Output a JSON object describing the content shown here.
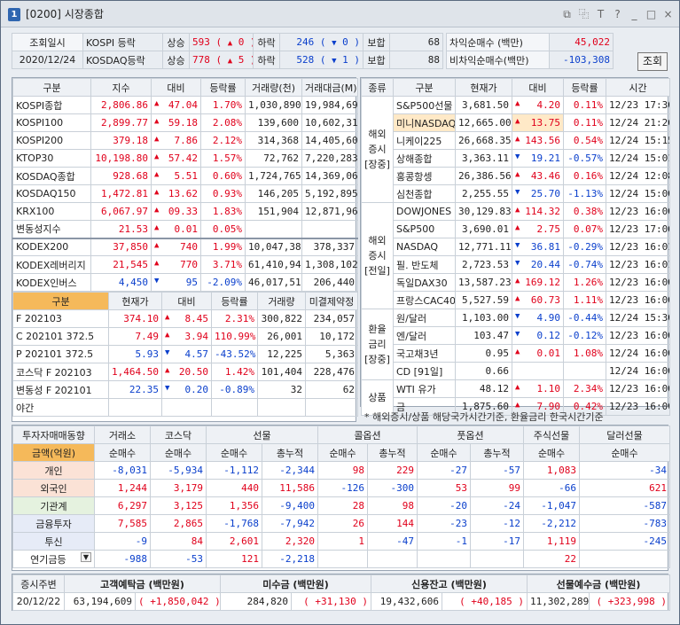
{
  "window": {
    "num": "1",
    "title": "[0200] 시장종합",
    "icons": [
      "layout-icon",
      "copy-icon",
      "T",
      "?",
      "_",
      "□",
      "×"
    ]
  },
  "summary": {
    "lookup_label": "조회일시",
    "date": "2020/12/24",
    "rows": [
      {
        "name": "KOSPI 등락",
        "up_label": "상승",
        "up": "593",
        "up_chg": "0",
        "down_label": "하락",
        "down": "246",
        "down_chg": "0",
        "flat_label": "보합",
        "flat": "68"
      },
      {
        "name": "KOSDAQ등락",
        "up_label": "상승",
        "up": "778",
        "up_chg": "5",
        "down_label": "하락",
        "down": "528",
        "down_chg": "1",
        "flat_label": "보합",
        "flat": "88"
      }
    ],
    "arb": [
      {
        "label": "차익순매수 (백만)",
        "value": "45,022"
      },
      {
        "label": "비차익순매수(백만)",
        "value": "-103,308"
      }
    ],
    "lookup_btn": "조회"
  },
  "indices": {
    "headers": [
      "구분",
      "지수",
      "대비",
      "등락률",
      "거래량(천)",
      "거래대금(M)"
    ],
    "rows": [
      {
        "name": "KOSPI종합",
        "v": "2,806.86",
        "dir": "up",
        "chg": "47.04",
        "pct": "1.70%",
        "vol": "1,030,890",
        "amt": "19,984,695"
      },
      {
        "name": "KOSPI100",
        "v": "2,899.77",
        "dir": "up",
        "chg": "59.18",
        "pct": "2.08%",
        "vol": "139,600",
        "amt": "10,602,313"
      },
      {
        "name": "KOSPI200",
        "v": "379.18",
        "dir": "up",
        "chg": "7.86",
        "pct": "2.12%",
        "vol": "314,368",
        "amt": "14,405,605"
      },
      {
        "name": "KTOP30",
        "v": "10,198.80",
        "dir": "up",
        "chg": "57.42",
        "pct": "1.57%",
        "vol": "72,762",
        "amt": "7,220,283"
      },
      {
        "name": "KOSDAQ종합",
        "v": "928.68",
        "dir": "up",
        "chg": "5.51",
        "pct": "0.60%",
        "vol": "1,724,765",
        "amt": "14,369,069"
      },
      {
        "name": "KOSDAQ150",
        "v": "1,472.81",
        "dir": "up",
        "chg": "13.62",
        "pct": "0.93%",
        "vol": "146,205",
        "amt": "5,192,895"
      },
      {
        "name": "KRX100",
        "v": "6,067.97",
        "dir": "up",
        "chg": "09.33",
        "pct": "1.83%",
        "vol": "151,904",
        "amt": "12,871,964"
      },
      {
        "name": "변동성지수",
        "v": "21.53",
        "dir": "up",
        "chg": "0.01",
        "pct": "0.05%",
        "vol": "",
        "amt": ""
      },
      {
        "name": "KODEX200",
        "v": "37,850",
        "dir": "up",
        "chg": "740",
        "pct": "1.99%",
        "vol": "10,047,380",
        "amt": "378,337"
      },
      {
        "name": "KODEX레버리지",
        "v": "21,545",
        "dir": "up",
        "chg": "770",
        "pct": "3.71%",
        "vol": "61,410,948",
        "amt": "1,308,102"
      },
      {
        "name": "KODEX인버스",
        "v": "4,450",
        "dir": "down",
        "chg": "95",
        "pct": "-2.09%",
        "vol": "46,017,519",
        "amt": "206,440"
      }
    ]
  },
  "futures": {
    "headers": [
      "구분",
      "현재가",
      "대비",
      "등락률",
      "거래량",
      "미결제약정"
    ],
    "rows": [
      {
        "name": "F 202103",
        "v": "374.10",
        "dir": "up",
        "chg": "8.45",
        "pct": "2.31%",
        "vol": "300,822",
        "oi": "234,057"
      },
      {
        "name": "C 202101 372.5",
        "v": "7.49",
        "dir": "up",
        "chg": "3.94",
        "pct": "110.99%",
        "vol": "26,001",
        "oi": "10,172"
      },
      {
        "name": "P 202101 372.5",
        "v": "5.93",
        "dir": "down",
        "chg": "4.57",
        "pct": "-43.52%",
        "vol": "12,225",
        "oi": "5,363"
      },
      {
        "name": "코스닥 F 202103",
        "v": "1,464.50",
        "dir": "up",
        "chg": "20.50",
        "pct": "1.42%",
        "vol": "101,404",
        "oi": "228,476"
      },
      {
        "name": "변동성 F 202101",
        "v": "22.35",
        "dir": "down",
        "chg": "0.20",
        "pct": "-0.89%",
        "vol": "32",
        "oi": "62"
      },
      {
        "name": "야간",
        "v": "",
        "dir": "",
        "chg": "",
        "pct": "",
        "vol": "",
        "oi": ""
      }
    ]
  },
  "global": {
    "headers": [
      "종류",
      "구분",
      "현재가",
      "대비",
      "등락률",
      "시간"
    ],
    "groups": [
      {
        "label": "해외\n증시\n[장중]",
        "rows": [
          {
            "name": "S&P500선물",
            "v": "3,681.50",
            "dir": "up",
            "chg": "4.20",
            "pct": "0.11%",
            "t": "12/23 17:30"
          },
          {
            "name": "미니NASDAQ",
            "v": "12,665.00",
            "dir": "up",
            "chg": "13.75",
            "pct": "0.11%",
            "t": "12/24 21:26",
            "hl": true
          },
          {
            "name": "니케이225",
            "v": "26,668.35",
            "dir": "up",
            "chg": "143.56",
            "pct": "0.54%",
            "t": "12/24 15:15"
          },
          {
            "name": "상해종합",
            "v": "3,363.11",
            "dir": "down",
            "chg": "19.21",
            "pct": "-0.57%",
            "t": "12/24 15:01"
          },
          {
            "name": "홍콩항셍",
            "v": "26,386.56",
            "dir": "up",
            "chg": "43.46",
            "pct": "0.16%",
            "t": "12/24 12:08"
          },
          {
            "name": "심천종합",
            "v": "2,255.55",
            "dir": "down",
            "chg": "25.70",
            "pct": "-1.13%",
            "t": "12/24 15:00"
          }
        ]
      },
      {
        "label": "해외\n증시\n[전일]",
        "rows": [
          {
            "name": "DOWJONES",
            "v": "30,129.83",
            "dir": "up",
            "chg": "114.32",
            "pct": "0.38%",
            "t": "12/23 16:00"
          },
          {
            "name": "S&P500",
            "v": "3,690.01",
            "dir": "up",
            "chg": "2.75",
            "pct": "0.07%",
            "t": "12/23 17:06"
          },
          {
            "name": "NASDAQ",
            "v": "12,771.11",
            "dir": "down",
            "chg": "36.81",
            "pct": "-0.29%",
            "t": "12/23 16:01"
          },
          {
            "name": "필. 반도체",
            "v": "2,723.53",
            "dir": "down",
            "chg": "20.44",
            "pct": "-0.74%",
            "t": "12/23 16:01"
          },
          {
            "name": "독일DAX30",
            "v": "13,587.23",
            "dir": "up",
            "chg": "169.12",
            "pct": "1.26%",
            "t": "12/23 16:00"
          },
          {
            "name": "프랑스CAC40",
            "v": "5,527.59",
            "dir": "up",
            "chg": "60.73",
            "pct": "1.11%",
            "t": "12/23 16:00"
          }
        ]
      },
      {
        "label": "환율\n금리\n[장중]",
        "rows": [
          {
            "name": "원/달러",
            "v": "1,103.00",
            "dir": "down",
            "chg": "4.90",
            "pct": "-0.44%",
            "t": "12/24 15:30"
          },
          {
            "name": "엔/달러",
            "v": "103.47",
            "dir": "down",
            "chg": "0.12",
            "pct": "-0.12%",
            "t": "12/23 16:00"
          },
          {
            "name": "국고채3년",
            "v": "0.95",
            "dir": "up",
            "chg": "0.01",
            "pct": "1.08%",
            "t": "12/24 16:00"
          },
          {
            "name": "CD [91일]",
            "v": "0.66",
            "dir": "",
            "chg": "",
            "pct": "",
            "t": "12/24 16:00"
          }
        ]
      },
      {
        "label": "상품",
        "rows": [
          {
            "name": "WTI 유가",
            "v": "48.12",
            "dir": "up",
            "chg": "1.10",
            "pct": "2.34%",
            "t": "12/23 16:00"
          },
          {
            "name": "금",
            "v": "1,875.60",
            "dir": "up",
            "chg": "7.90",
            "pct": "0.42%",
            "t": "12/23 16:00"
          }
        ]
      }
    ],
    "note": "* 해외증시/상품 해당국가시간기준, 환율금리 한국시간기준"
  },
  "investors": {
    "title": "투자자매매동향",
    "groups": [
      "거래소",
      "코스닥",
      "선물",
      "콜옵션",
      "풋옵션",
      "주식선물",
      "달러선물"
    ],
    "unit_label": "금액(억원)",
    "sub": [
      "순매수",
      "순매수",
      "순매수",
      "총누적",
      "순매수",
      "총누적",
      "순매수",
      "총누적",
      "순매수",
      "순매수"
    ],
    "rows": [
      {
        "name": "개인",
        "cls": "peach",
        "vals": [
          "-8,031",
          "-5,934",
          "-1,112",
          "-2,344",
          "98",
          "229",
          "-27",
          "-57",
          "1,083",
          "-34"
        ]
      },
      {
        "name": "외국인",
        "cls": "peach",
        "vals": [
          "1,244",
          "3,179",
          "440",
          "11,586",
          "-126",
          "-300",
          "53",
          "99",
          "-66",
          "621"
        ]
      },
      {
        "name": "기관계",
        "cls": "mint",
        "vals": [
          "6,297",
          "3,125",
          "1,356",
          "-9,400",
          "28",
          "98",
          "-20",
          "-24",
          "-1,047",
          "-587"
        ]
      },
      {
        "name": "금융투자",
        "cls": "lav",
        "vals": [
          "7,585",
          "2,865",
          "-1,768",
          "-7,942",
          "26",
          "144",
          "-23",
          "-12",
          "-2,212",
          "-783"
        ]
      },
      {
        "name": "투신",
        "cls": "lav",
        "vals": [
          "-9",
          "84",
          "2,601",
          "2,320",
          "1",
          "-47",
          "-1",
          "-17",
          "1,119",
          "-245"
        ]
      },
      {
        "name": "연기금등",
        "cls": "",
        "vals": [
          "-988",
          "-53",
          "121",
          "-2,218",
          "",
          "",
          "",
          "",
          "22",
          ""
        ]
      }
    ]
  },
  "funds": {
    "headers": [
      "증시주변",
      "고객예탁금 (백만원)",
      "미수금 (백만원)",
      "신용잔고 (백만원)",
      "선물예수금 (백만원)"
    ],
    "date": "20/12/22",
    "items": [
      {
        "v": "63,194,609",
        "chg": "+1,850,042"
      },
      {
        "v": "284,820",
        "chg": "+31,130"
      },
      {
        "v": "19,432,606",
        "chg": "+40,185"
      },
      {
        "v": "11,302,289",
        "chg": "+323,998"
      }
    ]
  }
}
